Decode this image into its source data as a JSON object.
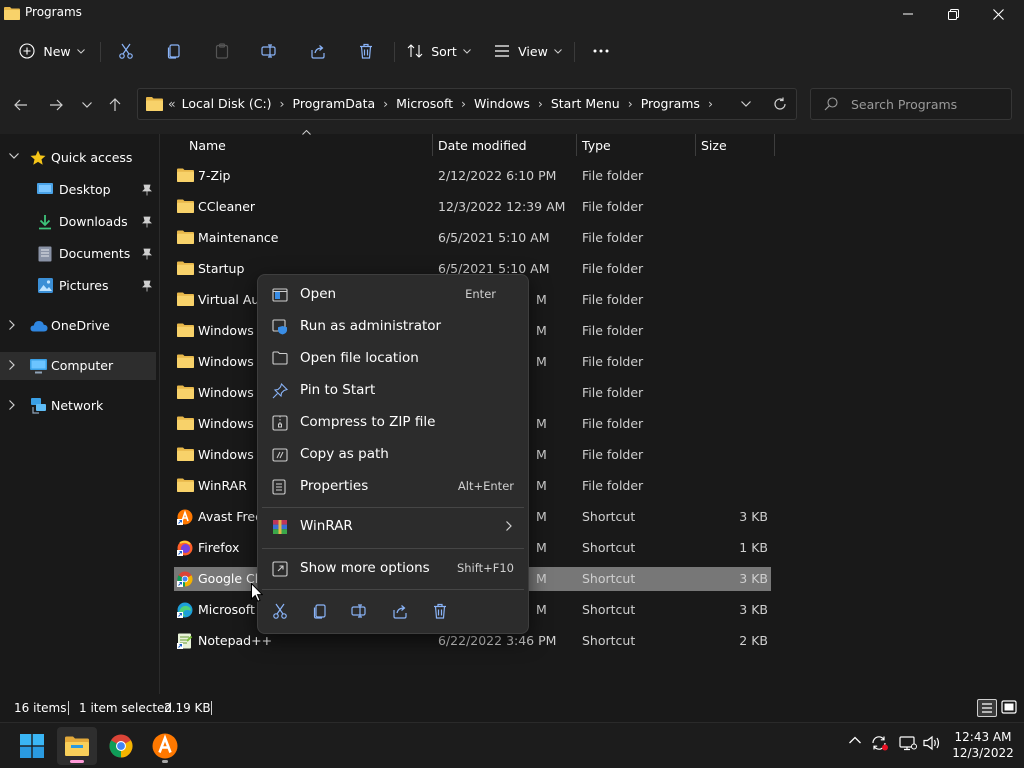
{
  "window": {
    "title": "Programs"
  },
  "toolbar": {
    "new_label": "New",
    "sort_label": "Sort",
    "view_label": "View",
    "more_label": "..."
  },
  "address": {
    "crumbs": [
      "Local Disk (C:)",
      "ProgramData",
      "Microsoft",
      "Windows",
      "Start Menu",
      "Programs"
    ]
  },
  "search": {
    "placeholder": "Search Programs"
  },
  "nav": {
    "quick_access": "Quick access",
    "desktop": "Desktop",
    "downloads": "Downloads",
    "documents": "Documents",
    "pictures": "Pictures",
    "onedrive": "OneDrive",
    "computer": "Computer",
    "network": "Network"
  },
  "columns": {
    "name": "Name",
    "date": "Date modified",
    "type": "Type",
    "size": "Size"
  },
  "files": [
    {
      "name": "7-Zip",
      "date": "2/12/2022 6:10 PM",
      "type": "File folder",
      "size": ""
    },
    {
      "name": "CCleaner",
      "date": "12/3/2022 12:39 AM",
      "type": "File folder",
      "size": ""
    },
    {
      "name": "Maintenance",
      "date": "6/5/2021 5:10 AM",
      "type": "File folder",
      "size": ""
    },
    {
      "name": "Startup",
      "date": "6/5/2021 5:10 AM",
      "type": "File folder",
      "size": ""
    },
    {
      "name": "Virtual Aud",
      "date": "M",
      "type": "File folder",
      "size": ""
    },
    {
      "name": "Windows A",
      "date": "M",
      "type": "File folder",
      "size": ""
    },
    {
      "name": "Windows E",
      "date": "M",
      "type": "File folder",
      "size": ""
    },
    {
      "name": "Windows P",
      "date": "",
      "type": "File folder",
      "size": ""
    },
    {
      "name": "Windows S",
      "date": "M",
      "type": "File folder",
      "size": ""
    },
    {
      "name": "Windows T",
      "date": "M",
      "type": "File folder",
      "size": ""
    },
    {
      "name": "WinRAR",
      "date": "M",
      "type": "File folder",
      "size": ""
    },
    {
      "name": "Avast Free",
      "date": "M",
      "type": "Shortcut",
      "size": "3 KB"
    },
    {
      "name": "Firefox",
      "date": "M",
      "type": "Shortcut",
      "size": "1 KB"
    },
    {
      "name": "Google Ch",
      "date": "M",
      "type": "Shortcut",
      "size": "3 KB"
    },
    {
      "name": "Microsoft E",
      "date": "M",
      "type": "Shortcut",
      "size": "3 KB"
    },
    {
      "name": "Notepad++",
      "date": "6/22/2022 3:46 PM",
      "type": "Shortcut",
      "size": "2 KB"
    }
  ],
  "context_menu": {
    "open": "Open",
    "open_key": "Enter",
    "run_admin": "Run as administrator",
    "open_location": "Open file location",
    "pin_start": "Pin to Start",
    "compress": "Compress to ZIP file",
    "copy_path": "Copy as path",
    "properties": "Properties",
    "properties_key": "Alt+Enter",
    "winrar": "WinRAR",
    "more_options": "Show more options",
    "more_options_key": "Shift+F10"
  },
  "status": {
    "items": "16 items",
    "selected": "1 item selected",
    "size": "2.19 KB"
  },
  "clock": {
    "time": "12:43 AM",
    "date": "12/3/2022"
  }
}
